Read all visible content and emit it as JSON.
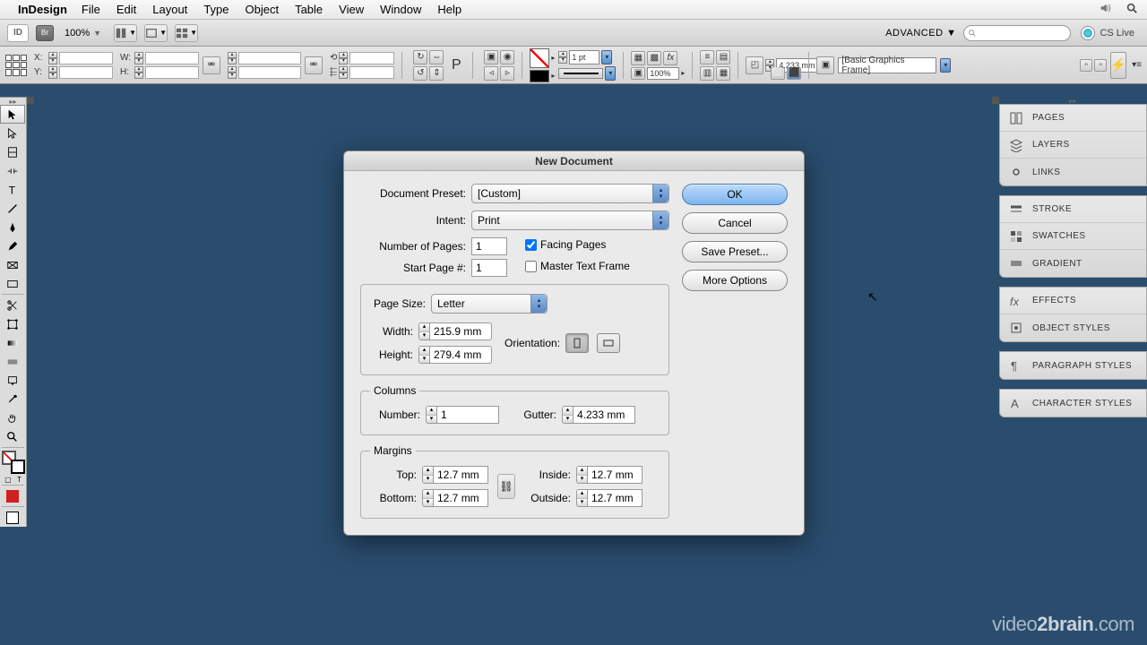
{
  "menubar": {
    "appname": "InDesign",
    "items": [
      "File",
      "Edit",
      "Layout",
      "Type",
      "Object",
      "Table",
      "View",
      "Window",
      "Help"
    ]
  },
  "appbar": {
    "zoom": "100%",
    "workspace": "ADVANCED",
    "cslive": "CS Live"
  },
  "controlbar": {
    "x_label": "X:",
    "y_label": "Y:",
    "w_label": "W:",
    "h_label": "H:",
    "stroke_weight": "1 pt",
    "opacity": "100%",
    "corner": "4.233 mm",
    "style": "[Basic Graphics Frame]"
  },
  "panels": {
    "g1": [
      "PAGES",
      "LAYERS",
      "LINKS"
    ],
    "g2": [
      "STROKE",
      "SWATCHES",
      "GRADIENT"
    ],
    "g3": [
      "EFFECTS",
      "OBJECT STYLES"
    ],
    "g4": [
      "PARAGRAPH STYLES"
    ],
    "g5": [
      "CHARACTER STYLES"
    ]
  },
  "dialog": {
    "title": "New Document",
    "preset_label": "Document Preset:",
    "preset_value": "[Custom]",
    "intent_label": "Intent:",
    "intent_value": "Print",
    "numpages_label": "Number of Pages:",
    "numpages_value": "1",
    "startpage_label": "Start Page #:",
    "startpage_value": "1",
    "facing_label": "Facing Pages",
    "master_label": "Master Text Frame",
    "pagesize_label": "Page Size:",
    "pagesize_value": "Letter",
    "width_label": "Width:",
    "width_value": "215.9 mm",
    "height_label": "Height:",
    "height_value": "279.4 mm",
    "orientation_label": "Orientation:",
    "columns_legend": "Columns",
    "colnum_label": "Number:",
    "colnum_value": "1",
    "gutter_label": "Gutter:",
    "gutter_value": "4.233 mm",
    "margins_legend": "Margins",
    "top_label": "Top:",
    "top_value": "12.7 mm",
    "bottom_label": "Bottom:",
    "bottom_value": "12.7 mm",
    "inside_label": "Inside:",
    "inside_value": "12.7 mm",
    "outside_label": "Outside:",
    "outside_value": "12.7 mm",
    "ok": "OK",
    "cancel": "Cancel",
    "save_preset": "Save Preset...",
    "more_options": "More Options"
  },
  "watermark": {
    "a": "video",
    "b": "2",
    "c": "brain",
    "d": ".com"
  }
}
